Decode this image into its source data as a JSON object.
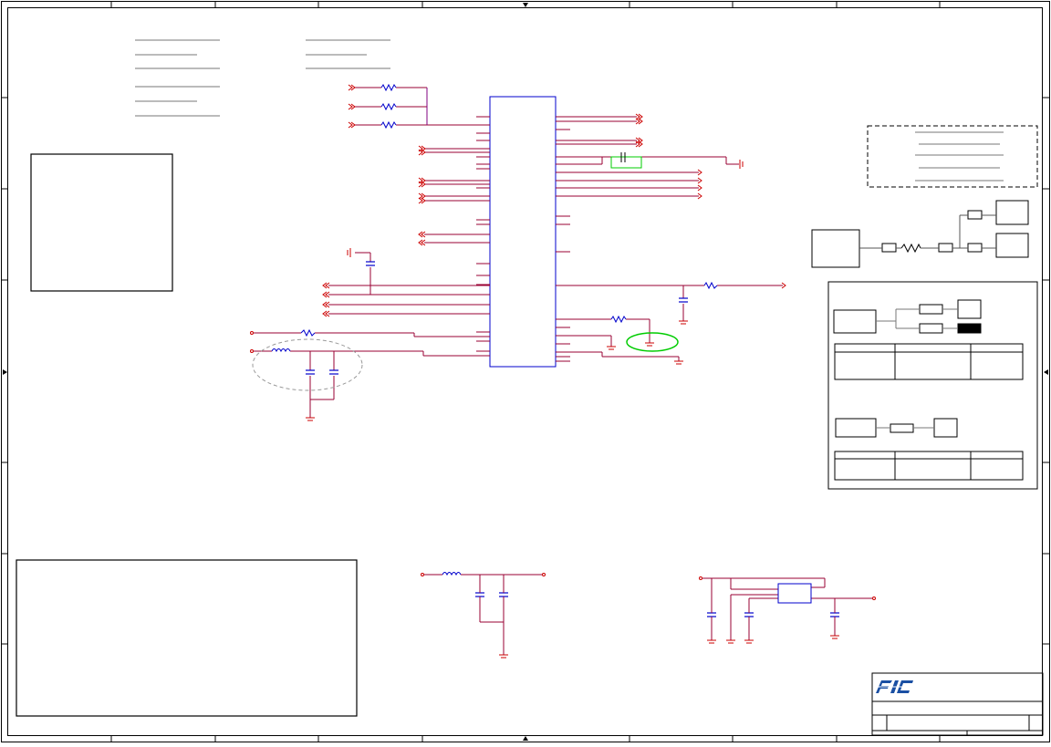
{
  "logo": {
    "text": "FIC"
  },
  "colors": {
    "frame": "#000000",
    "net": "#990033",
    "wire": "#800080",
    "ic_outline": "#0000cc",
    "ground": "#cc0000",
    "annotation": "#00cc00",
    "note_box": "#000000",
    "callout_dash": "#888888",
    "logo_blue": "#1a4fa3"
  }
}
